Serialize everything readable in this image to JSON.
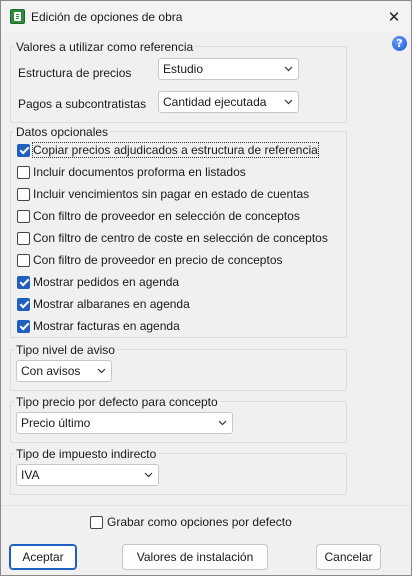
{
  "window": {
    "title": "Edición de opciones de obra"
  },
  "icons": {
    "app": "spreadsheet-app-icon",
    "close": "close-icon",
    "help": "help-icon",
    "dropdown": "chevron-down-icon"
  },
  "colors": {
    "accent": "#1f5fbf",
    "help": "#1d4fd0",
    "app_icon": "#2e8b3e"
  },
  "reference": {
    "title": "Valores a utilizar como referencia",
    "price_structure_label": "Estructura de precios",
    "price_structure_value": "Estudio",
    "subcontractor_payments_label": "Pagos a subcontratistas",
    "subcontractor_payments_value": "Cantidad ejecutada"
  },
  "optional": {
    "title": "Datos opcionales",
    "items": [
      {
        "label": "Copiar precios adjudicados a estructura de referencia",
        "checked": true
      },
      {
        "label": "Incluir documentos proforma en listados",
        "checked": false
      },
      {
        "label": "Incluir vencimientos sin pagar en estado de cuentas",
        "checked": false
      },
      {
        "label": "Con filtro de proveedor en selección de conceptos",
        "checked": false
      },
      {
        "label": "Con filtro de centro de coste en selección de conceptos",
        "checked": false
      },
      {
        "label": "Con filtro de proveedor en precio de conceptos",
        "checked": false
      },
      {
        "label": "Mostrar pedidos en agenda",
        "checked": true
      },
      {
        "label": "Mostrar albaranes en agenda",
        "checked": true
      },
      {
        "label": "Mostrar facturas en agenda",
        "checked": true
      }
    ]
  },
  "alert_level": {
    "title": "Tipo nivel de aviso",
    "value": "Con avisos"
  },
  "default_price": {
    "title": "Tipo precio por defecto para concepto",
    "value": "Precio último"
  },
  "indirect_tax": {
    "title": "Tipo de impuesto indirecto",
    "value": "IVA"
  },
  "footer": {
    "save_default_label": "Grabar como opciones por defecto",
    "save_default_checked": false,
    "accept_label": "Aceptar",
    "install_values_label": "Valores de instalación",
    "cancel_label": "Cancelar"
  }
}
